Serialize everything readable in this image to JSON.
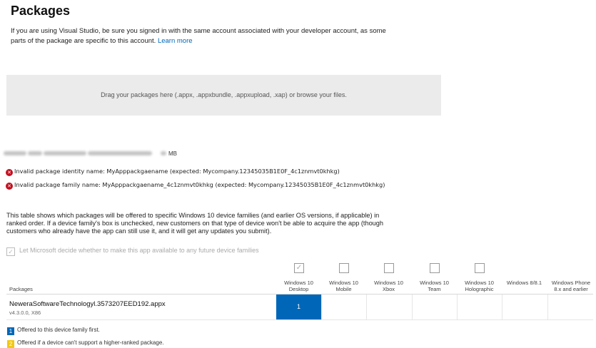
{
  "page": {
    "title": "Packages",
    "intro_text": "If you are using Visual Studio, be sure you signed in with the same account associated with your developer account, as some parts of the package are specific to this account.",
    "learn_more": "Learn more"
  },
  "dropzone": {
    "text": "Drag your packages here (.appx, .appxbundle, .appxupload, .xap) or browse your files."
  },
  "uploaded": {
    "size_unit": "MB",
    "errors": [
      "Invalid package identity name: MyApppackgaename (expected: Mycompany.12345035B1E0F_4c1znmvt0khkg)",
      "Invalid package family name: MyApppackgaename_4c1znmvt0khkg (expected: Mycompany.12345035B1E0F_4c1znmvt0khkg)"
    ]
  },
  "families": {
    "description": "This table shows which packages will be offered to specific Windows 10 device families (and earlier OS versions, if applicable) in ranked order. If a device family's box is unchecked, new customers on that type of device won't be able to acquire the app (though customers who already have the app can still use it, and it will get any updates you submit).",
    "auto_checkbox_label": "Let Microsoft decide whether to make this app available to any future device families",
    "packages_header": "Packages",
    "columns": [
      {
        "line1": "Windows 10",
        "line2": "Desktop",
        "has_checkbox": true,
        "checked": true
      },
      {
        "line1": "Windows 10",
        "line2": "Mobile",
        "has_checkbox": true,
        "checked": false
      },
      {
        "line1": "Windows 10",
        "line2": "Xbox",
        "has_checkbox": true,
        "checked": false
      },
      {
        "line1": "Windows 10",
        "line2": "Team",
        "has_checkbox": true,
        "checked": false
      },
      {
        "line1": "Windows 10",
        "line2": "Holographic",
        "has_checkbox": true,
        "checked": false
      },
      {
        "line1": "Windows 8/8.1",
        "line2": "",
        "has_checkbox": false,
        "checked": false
      },
      {
        "line1": "Windows Phone",
        "line2": "8.x and earlier",
        "has_checkbox": false,
        "checked": false
      }
    ],
    "package_row": {
      "name": "NeweraSoftwareTechnologyl.3573207EED192.appx",
      "version": "v4.3.0.0, X86",
      "rank_desktop": "1"
    },
    "legend": [
      {
        "badge": "1",
        "text": "Offered to this device family first.",
        "color": "#0067b8"
      },
      {
        "badge": "2",
        "text": "Offered if a device can't support a higher-ranked package.",
        "color": "#f2c811"
      }
    ]
  }
}
